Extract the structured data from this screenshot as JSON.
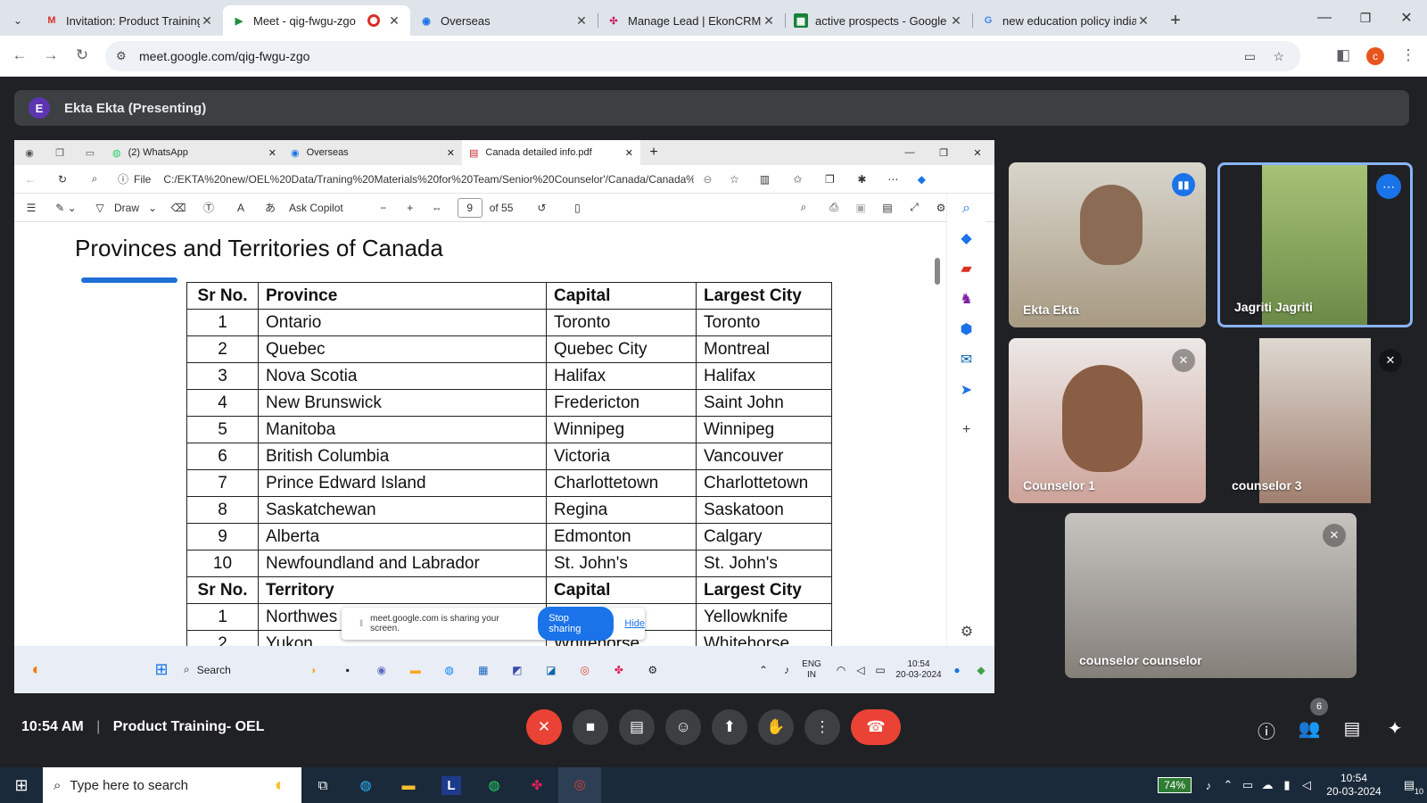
{
  "browser": {
    "tabs": [
      {
        "title": "Invitation: Product Training-",
        "icon": "gmail-icon",
        "active": false
      },
      {
        "title": "Meet - qig-fwgu-zgo",
        "icon": "meet-icon",
        "active": true
      },
      {
        "title": "Overseas",
        "icon": "overseas-icon",
        "active": false
      },
      {
        "title": "Manage Lead | EkonCRM",
        "icon": "crm-icon",
        "active": false
      },
      {
        "title": "active prospects - Google Sh",
        "icon": "sheets-icon",
        "active": false
      },
      {
        "title": "new education policy india -",
        "icon": "google-icon",
        "active": false
      }
    ],
    "url": "meet.google.com/qig-fwgu-zgo",
    "profile_initial": "c"
  },
  "meet": {
    "presenter_initial": "E",
    "presenter_label": "Ekta Ekta (Presenting)",
    "time": "10:54 AM",
    "separator": "|",
    "meeting_title": "Product Training- OEL",
    "participant_count": "6",
    "participants": [
      {
        "name": "Ekta Ekta",
        "muted": false,
        "bg": "#b8b0a0"
      },
      {
        "name": "Jagriti Jagriti",
        "muted": false,
        "bg": "#9fb46d"
      },
      {
        "name": "Counselor 1",
        "muted": true,
        "bg": "#c9a6a0"
      },
      {
        "name": "counselor 3",
        "muted": true,
        "bg": "#b59a8a"
      },
      {
        "name": "counselor counselor",
        "muted": true,
        "bg": "#8f8a86"
      }
    ]
  },
  "shared": {
    "edge_tabs": [
      {
        "title": "(2) WhatsApp"
      },
      {
        "title": "Overseas"
      },
      {
        "title": "Canada detailed info.pdf"
      }
    ],
    "file_label": "File",
    "path": "C:/EKTA%20new/OEL%20Data/Traning%20Materials%20for%20Team/Senior%20Counselor'/Canada/Canada%2...",
    "draw_label": "Draw",
    "copilot_label": "Ask Copilot",
    "page_number": "9",
    "page_total": "of 55",
    "pdf_title": "Provinces and Territories of Canada",
    "table": {
      "province_header": [
        "Sr No.",
        "Province",
        "Capital",
        "Largest City"
      ],
      "provinces": [
        [
          "1",
          "Ontario",
          "Toronto",
          "Toronto"
        ],
        [
          "2",
          "Quebec",
          "Quebec City",
          "Montreal"
        ],
        [
          "3",
          "Nova Scotia",
          "Halifax",
          "Halifax"
        ],
        [
          "4",
          "New Brunswick",
          "Fredericton",
          "Saint John"
        ],
        [
          "5",
          "Manitoba",
          "Winnipeg",
          "Winnipeg"
        ],
        [
          "6",
          "British Columbia",
          "Victoria",
          "Vancouver"
        ],
        [
          "7",
          "Prince Edward Island",
          "Charlottetown",
          "Charlottetown"
        ],
        [
          "8",
          "Saskatchewan",
          "Regina",
          "Saskatoon"
        ],
        [
          "9",
          "Alberta",
          "Edmonton",
          "Calgary"
        ],
        [
          "10",
          "Newfoundland and Labrador",
          "St. John's",
          "St. John's"
        ]
      ],
      "territory_header": [
        "Sr No.",
        "Territory",
        "Capital",
        "Largest City"
      ],
      "territories": [
        [
          "1",
          "Northwes",
          "",
          "Yellowknife"
        ],
        [
          "2",
          "Yukon",
          "Whitehorse",
          "Whitehorse"
        ]
      ]
    },
    "share_notice": {
      "text": "meet.google.com is sharing your screen.",
      "stop": "Stop sharing",
      "hide": "Hide"
    },
    "inner_taskbar": {
      "search": "Search",
      "lang": "ENG",
      "region": "IN",
      "time": "10:54",
      "date": "20-03-2024"
    }
  },
  "os_taskbar": {
    "search_placeholder": "Type here to search",
    "battery": "74%",
    "time": "10:54",
    "date": "20-03-2024",
    "notifications": "10"
  }
}
